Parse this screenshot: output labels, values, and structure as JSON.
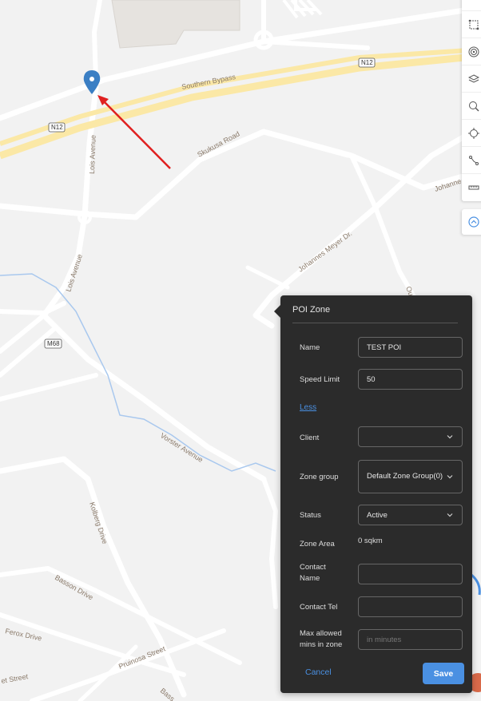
{
  "map": {
    "road_labels": {
      "southern_bypass": "Southern Bypass",
      "skukusa_road": "Skukusa Road",
      "lois_avenue_n": "Lois Avenue",
      "lois_avenue_s": "Lois Avenue",
      "johannes_meyer": "Johannes Meyer Dr.",
      "johannes_right": "Johanne",
      "vorster_avenue": "Vorster Avenue",
      "kolberg_drive": "Kolberg Drive",
      "basson_drive": "Basson Drive",
      "ferox_drive": "Ferox Drive",
      "pruinosa_street": "Pruinosa Street",
      "bet_street": "et Street",
      "bass_partial": "Bass",
      "ou_partial": "Ou"
    },
    "shields": {
      "n12_top": "N12",
      "n12_left": "N12",
      "m68": "M68"
    },
    "marker_icon": "map-pin-icon",
    "arrow_color": "#e02020"
  },
  "toolbar": {
    "tools": [
      "draw-polygon-icon",
      "radius-icon",
      "layers-icon",
      "zoom-search-icon",
      "locate-icon",
      "route-icon",
      "ruler-icon"
    ],
    "collapse_icon": "chevron-up-circle-icon"
  },
  "panel": {
    "title": "POI Zone",
    "name_label": "Name",
    "name_value": "TEST POI",
    "speed_label": "Speed Limit",
    "speed_value": "50",
    "less_link": "Less",
    "client_label": "Client",
    "client_value": "",
    "zone_group_label": "Zone group",
    "zone_group_value": "Default Zone Group(0)",
    "status_label": "Status",
    "status_value": "Active",
    "zone_area_label": "Zone Area",
    "zone_area_value": "0 sqkm",
    "contact_name_label": "Contact Name",
    "contact_name_value": "",
    "contact_tel_label": "Contact Tel",
    "contact_tel_value": "",
    "max_mins_label": "Max allowed mins in zone",
    "max_mins_placeholder": "in minutes",
    "cancel": "Cancel",
    "save": "Save"
  },
  "colors": {
    "accent": "#4a90e2",
    "panel_bg": "#2b2b2b",
    "highway": "#fbe8a6"
  }
}
